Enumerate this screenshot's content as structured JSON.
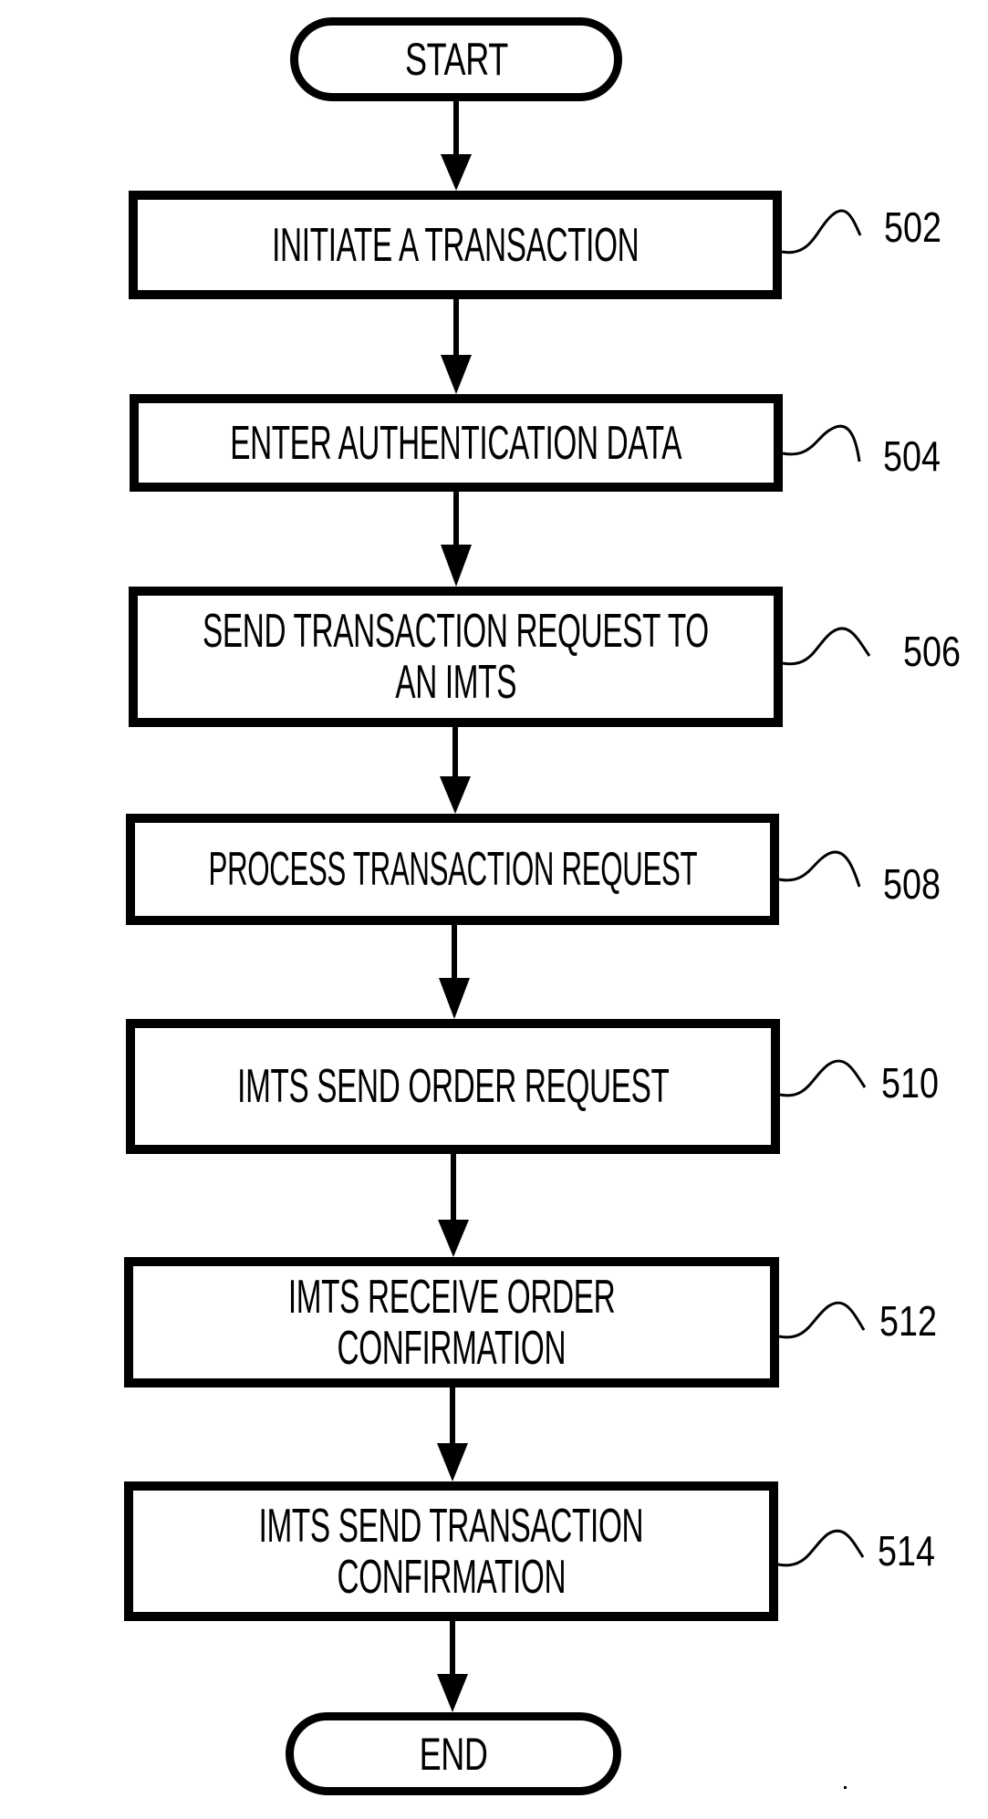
{
  "figure": {
    "start_label": "START",
    "end_label": "END",
    "steps": [
      {
        "ref": "502",
        "lines": [
          "INITIATE A TRANSACTION"
        ]
      },
      {
        "ref": "504",
        "lines": [
          "ENTER AUTHENTICATION DATA"
        ]
      },
      {
        "ref": "506",
        "lines": [
          "SEND TRANSACTION REQUEST TO",
          "AN IMTS"
        ]
      },
      {
        "ref": "508",
        "lines": [
          "PROCESS TRANSACTION REQUEST"
        ]
      },
      {
        "ref": "510",
        "lines": [
          "IMTS SEND ORDER REQUEST"
        ]
      },
      {
        "ref": "512",
        "lines": [
          "IMTS RECEIVE ORDER",
          "CONFIRMATION"
        ]
      },
      {
        "ref": "514",
        "lines": [
          "IMTS SEND TRANSACTION",
          "CONFIRMATION"
        ]
      }
    ],
    "colors": {
      "ink": "#000000",
      "background": "#ffffff"
    }
  }
}
